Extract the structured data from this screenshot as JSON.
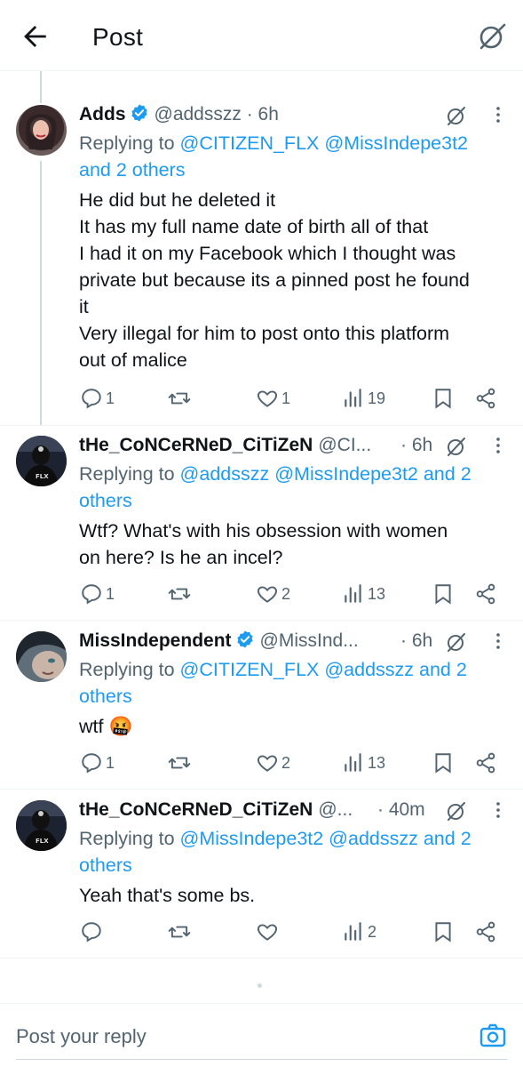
{
  "header": {
    "title": "Post",
    "back_icon": "arrow-left-icon",
    "grok_icon": "grok-icon"
  },
  "colors": {
    "link": "#1d9bf0",
    "secondary": "#536471",
    "primary_text": "#0f1419",
    "verified": "#1d9bf0",
    "like_count_red": "#f91880"
  },
  "previous_actions": {
    "views": "19"
  },
  "replies": [
    {
      "name": "Adds",
      "verified": true,
      "handle": "@addsszz",
      "time": "· 6h",
      "replying_prefix": "Replying to ",
      "replying_lines": [
        "@CITIZEN_FLX @MissIndepe3t2",
        "and 2 others"
      ],
      "text_lines": [
        "He did but he deleted it",
        "It has my full name date of birth all of that",
        "I had it on my Facebook which I thought was",
        "private but because its a pinned post he found",
        "it",
        "Very illegal for him to post onto this platform",
        "out of malice"
      ],
      "stats": {
        "replies": "1",
        "reposts": "",
        "likes": "1",
        "views": "19"
      }
    },
    {
      "name": "tHe_CoNCeRNeD_CiTiZeN",
      "verified": false,
      "handle": "@CI...",
      "time": "· 6h",
      "replying_prefix": "Replying to ",
      "replying_lines": [
        "@addsszz @MissIndepe3t2 and 2",
        "others"
      ],
      "text_lines": [
        "Wtf? What's with his obsession with women",
        "on here? Is he an incel?"
      ],
      "stats": {
        "replies": "1",
        "reposts": "",
        "likes": "2",
        "views": "13"
      }
    },
    {
      "name": "MissIndependent",
      "verified": true,
      "handle": "@MissInd...",
      "time": "· 6h",
      "replying_prefix": "Replying to ",
      "replying_lines": [
        "@CITIZEN_FLX @addsszz and 2",
        "others"
      ],
      "text_lines": [
        "wtf 🤬"
      ],
      "stats": {
        "replies": "1",
        "reposts": "",
        "likes": "2",
        "views": "13"
      }
    },
    {
      "name": "tHe_CoNCeRNeD_CiTiZeN",
      "verified": false,
      "handle": "@...",
      "time": "· 40m",
      "replying_prefix": "Replying to ",
      "replying_lines": [
        "@MissIndepe3t2 @addsszz and 2",
        "others"
      ],
      "text_lines": [
        "Yeah that's some bs."
      ],
      "stats": {
        "replies": "",
        "reposts": "",
        "likes": "",
        "views": "2"
      }
    }
  ],
  "composer": {
    "placeholder": "Post your reply",
    "camera_icon": "camera-icon"
  }
}
